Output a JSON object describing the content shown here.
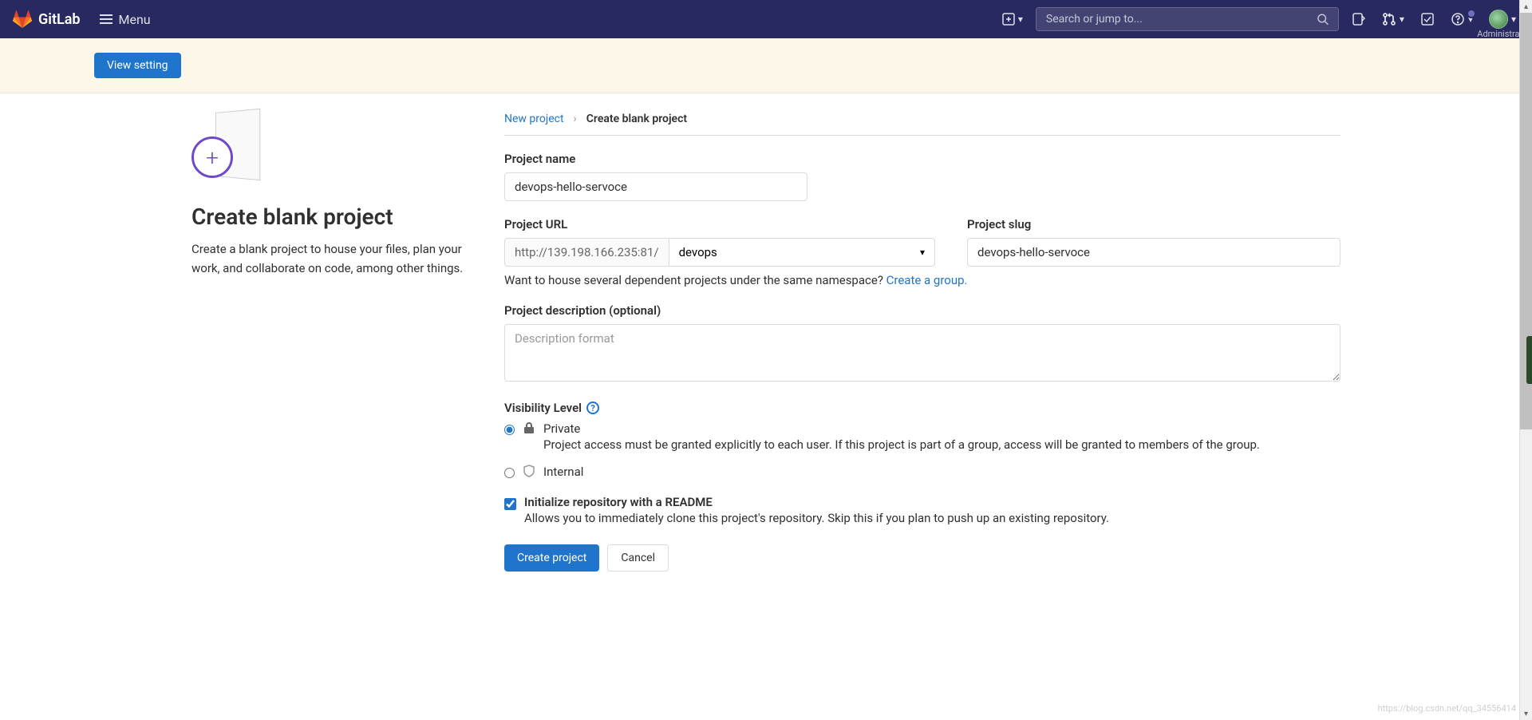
{
  "nav": {
    "brand": "GitLab",
    "menu_label": "Menu",
    "search_placeholder": "Search or jump to...",
    "admin_label": "Administrator"
  },
  "banner": {
    "view_setting_label": "View setting"
  },
  "sidebar": {
    "title": "Create blank project",
    "description": "Create a blank project to house your files, plan your work, and collaborate on code, among other things."
  },
  "breadcrumb": {
    "parent": "New project",
    "current": "Create blank project"
  },
  "form": {
    "project_name_label": "Project name",
    "project_name_value": "devops-hello-servoce",
    "project_url_label": "Project URL",
    "project_url_prefix": "http://139.198.166.235:81/",
    "namespace_value": "devops",
    "project_slug_label": "Project slug",
    "project_slug_value": "devops-hello-servoce",
    "group_help_text": "Want to house several dependent projects under the same namespace? ",
    "group_help_link": "Create a group.",
    "description_label": "Project description (optional)",
    "description_placeholder": "Description format",
    "visibility_label": "Visibility Level",
    "visibility": {
      "private": {
        "title": "Private",
        "desc": "Project access must be granted explicitly to each user. If this project is part of a group, access will be granted to members of the group."
      },
      "internal": {
        "title": "Internal"
      }
    },
    "readme": {
      "title": "Initialize repository with a README",
      "desc": "Allows you to immediately clone this project's repository. Skip this if you plan to push up an existing repository."
    },
    "create_button": "Create project",
    "cancel_button": "Cancel"
  },
  "watermark": "https://blog.csdn.net/qq_34556414"
}
